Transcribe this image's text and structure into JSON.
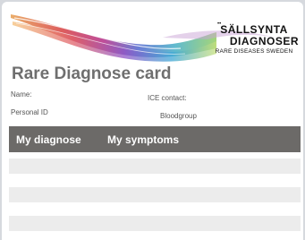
{
  "logo": {
    "line1": "SÄLLSYNTA",
    "line2": "DIAGNOSER",
    "line3": "RARE DISEASES SWEDEN"
  },
  "card": {
    "title": "Rare Diagnose card",
    "fields": {
      "name": "Name:",
      "personal_id": "Personal ID",
      "ice_contact": "ICE contact:",
      "bloodgroup": "Bloodgroup"
    },
    "table": {
      "columns": [
        "My diagnose",
        "My symptoms"
      ],
      "rows": [
        "",
        "",
        ""
      ]
    }
  },
  "colors": {
    "header_bar": "#6c6a68",
    "title_text": "#6f6f6f",
    "row_fill": "#ececec"
  }
}
